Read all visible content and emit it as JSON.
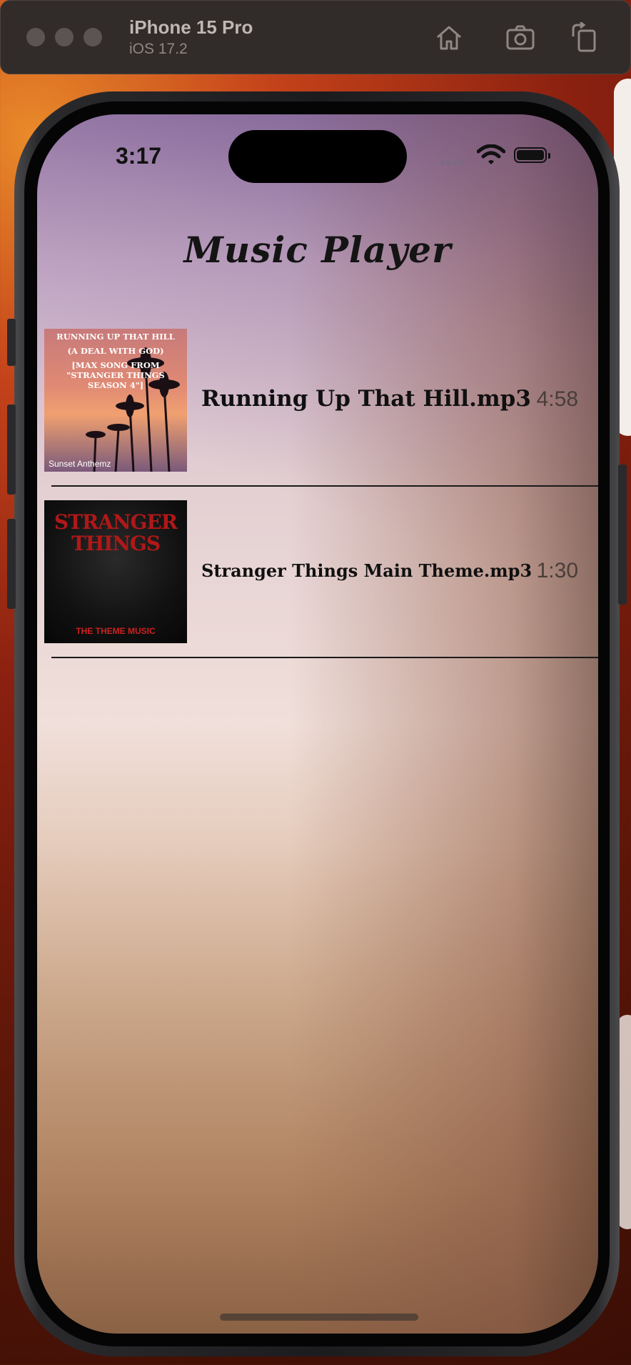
{
  "simulator": {
    "device_name": "iPhone 15 Pro",
    "os_version": "iOS 17.2",
    "buttons": [
      "home-icon",
      "screenshot-icon",
      "rotate-icon"
    ]
  },
  "status_bar": {
    "time": "3:17"
  },
  "app": {
    "title": "Music Player",
    "songs": [
      {
        "name": "Running Up That Hill.mp3",
        "duration": "4:58",
        "artwork": {
          "lines": [
            "RUNNING UP THAT HILL",
            "(A DEAL WITH GOD)",
            "[MAX SONG FROM \"STRANGER THINGS SEASON 4\"]"
          ],
          "footer": "Sunset Anthemz"
        }
      },
      {
        "name": "Stranger Things Main Theme.mp3",
        "duration": "1:30",
        "artwork": {
          "title": "STRANGER THINGS",
          "footer": "THE THEME MUSIC"
        }
      }
    ]
  }
}
